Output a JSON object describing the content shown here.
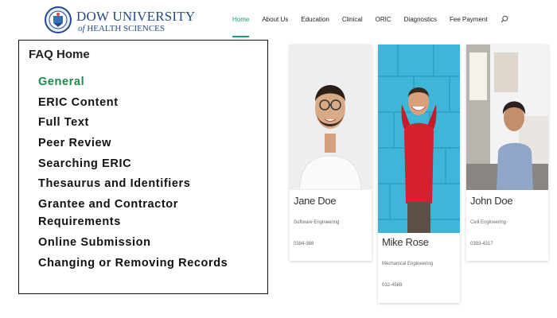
{
  "header": {
    "logo": {
      "line1": "DOW UNIVERSITY",
      "line2_of": "of",
      "line2_main": "HEALTH SCIENCES"
    },
    "nav": [
      {
        "label": "Home",
        "active": true
      },
      {
        "label": "About Us"
      },
      {
        "label": "Education"
      },
      {
        "label": "Clinical"
      },
      {
        "label": "ORIC"
      },
      {
        "label": "Diagnostics"
      },
      {
        "label": "Fee Payment"
      }
    ],
    "search_icon": "search-icon",
    "accent_color": "#1e9e6b"
  },
  "faq": {
    "title": "FAQ Home",
    "items": [
      "General",
      "ERIC Content",
      "Full Text",
      "Peer Review",
      "Searching ERIC",
      "Thesaurus and Identifiers",
      "Grantee and Contractor Requirements",
      "Online Submission",
      "Changing or Removing Records"
    ],
    "current_item_color": "#1e8a4e"
  },
  "team": [
    {
      "name": "Jane Doe",
      "role": "Software Engineering",
      "phone": "0394-988"
    },
    {
      "name": "Mike Rose",
      "role": "Mechanical Engineering",
      "phone": "032-4588"
    },
    {
      "name": "John Doe",
      "role": "Civil Engineering",
      "phone": "0393-4317"
    }
  ]
}
